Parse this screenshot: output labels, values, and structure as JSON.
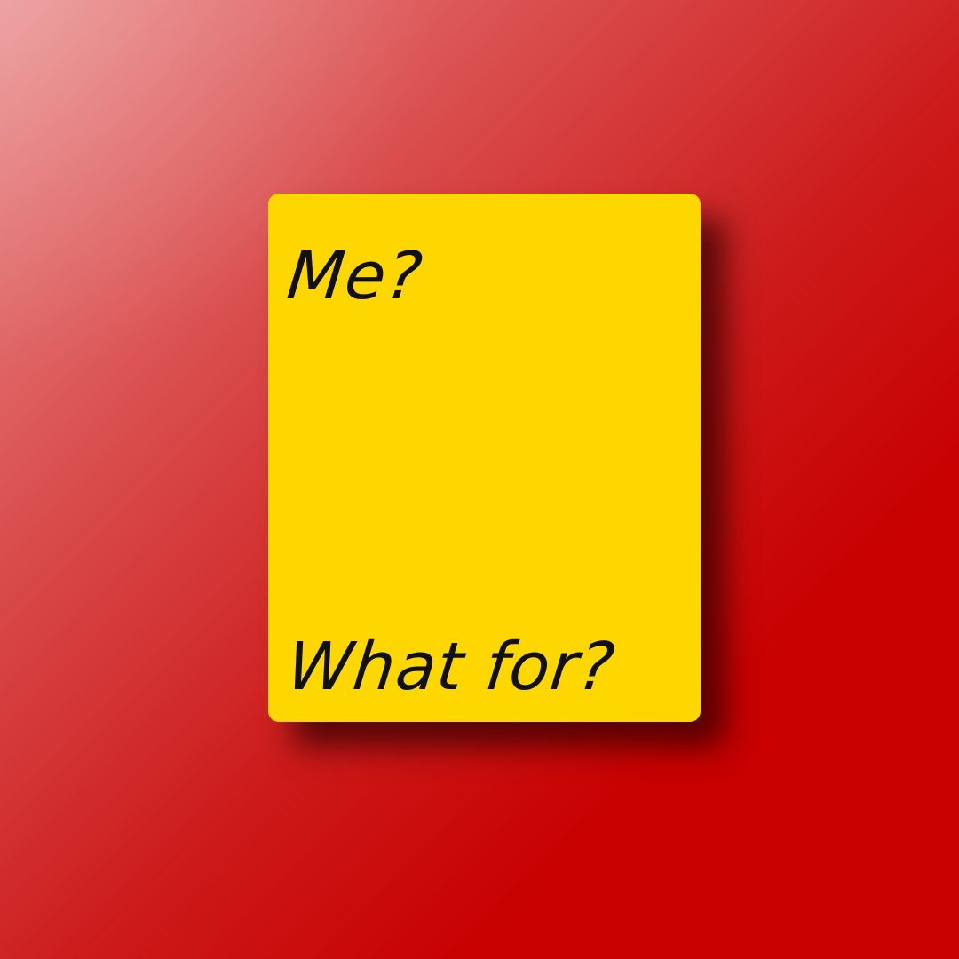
{
  "card": {
    "top_text": "Me?",
    "bottom_text": "What for?"
  },
  "colors": {
    "background_light": "#e98f8f",
    "background_dark": "#c80000",
    "card": "#ffd700",
    "text": "#111111"
  }
}
